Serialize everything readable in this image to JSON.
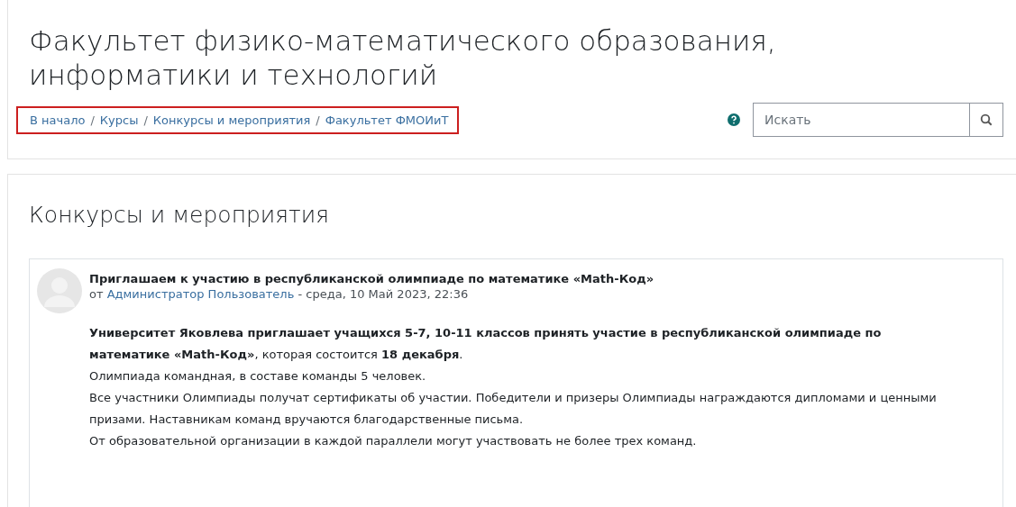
{
  "header": {
    "title": "Факультет физико-математического образования, информатики и технологий",
    "breadcrumb": {
      "highlighted": true,
      "items": [
        "В начало",
        "Курсы",
        "Конкурсы и мероприятия",
        "Факультет ФМОИиТ"
      ],
      "separator": "/"
    },
    "search": {
      "placeholder": "Искать"
    }
  },
  "section": {
    "heading": "Конкурсы и мероприятия",
    "post": {
      "title": "Приглашаем к участию в республиканской олимпиаде по математике «Math-Код»",
      "by": "от",
      "author": "Администратор Пользователь",
      "date": "- среда, 10 Май 2023, 22:36",
      "paragraphs": [
        "**Университет Яковлева приглашает учащихся 5-7, 10-11 классов принять участие в республиканской олимпиаде по математике «Math-Код»**, которая состоится **18 декабря**.",
        "Олимпиада командная, в составе команды 5 человек.",
        "Все участники Олимпиады получат сертификаты об участии. Победители и призеры Олимпиады награждаются дипломами и ценными призами. Наставникам команд вручаются благодарственные письма.",
        "От образовательной организации в каждой параллели могут участвовать не более трех команд."
      ]
    }
  }
}
